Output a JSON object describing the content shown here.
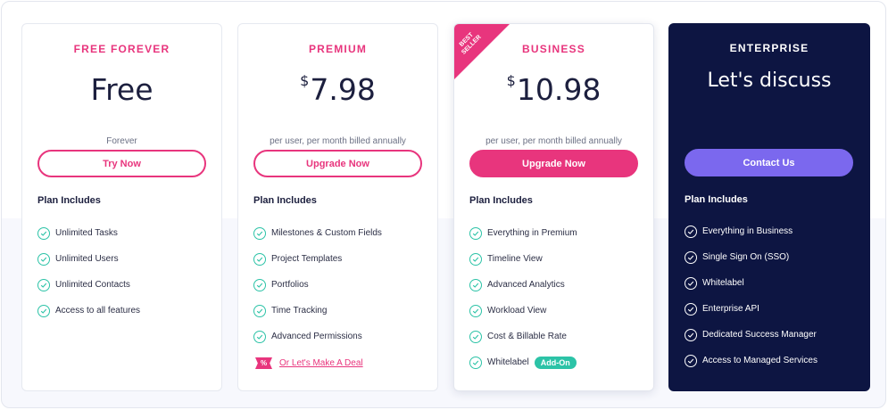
{
  "colors": {
    "accent": "#e8357d",
    "check": "#2cc3a7",
    "enterprise_bg": "#0d1542",
    "enterprise_button": "#7b68ee"
  },
  "plans": [
    {
      "name": "FREE FOREVER",
      "price": "Free",
      "price_sub": "Forever",
      "button": "Try Now",
      "includes_label": "Plan Includes",
      "features": [
        "Unlimited Tasks",
        "Unlimited Users",
        "Unlimited Contacts",
        "Access to all features"
      ]
    },
    {
      "name": "PREMIUM",
      "currency": "$",
      "price": "7.98",
      "price_sub": "per user, per month billed annually",
      "button": "Upgrade Now",
      "includes_label": "Plan Includes",
      "features": [
        "Milestones & Custom Fields",
        "Project Templates",
        "Portfolios",
        "Time Tracking",
        "Advanced Permissions"
      ],
      "deal_badge": "%",
      "deal_link": "Or Let's Make A Deal"
    },
    {
      "name": "BUSINESS",
      "ribbon": "BEST SELLER",
      "currency": "$",
      "price": "10.98",
      "price_sub": "per user, per month billed annually",
      "button": "Upgrade Now",
      "includes_label": "Plan Includes",
      "features": [
        "Everything in Premium",
        "Timeline View",
        "Advanced Analytics",
        "Workload View",
        "Cost & Billable Rate",
        "Whitelabel"
      ],
      "addon_badge": "Add-On"
    },
    {
      "name": "ENTERPRISE",
      "price": "Let's discuss",
      "button": "Contact Us",
      "includes_label": "Plan Includes",
      "features": [
        "Everything in Business",
        "Single Sign On (SSO)",
        "Whitelabel",
        "Enterprise API",
        "Dedicated Success Manager",
        "Access to Managed Services"
      ]
    }
  ]
}
